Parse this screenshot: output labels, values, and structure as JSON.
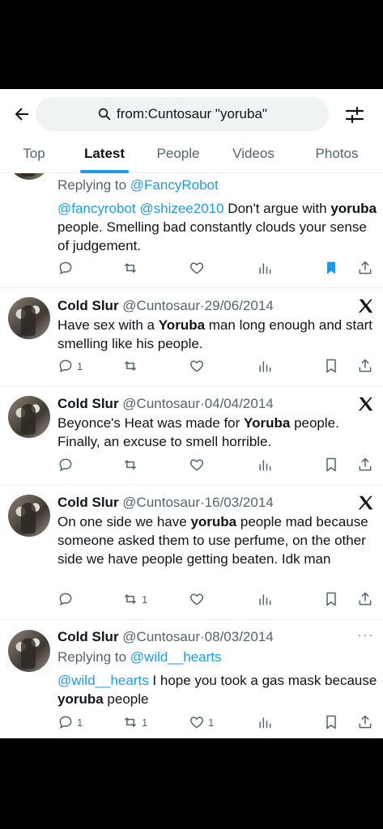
{
  "search": {
    "query": "from:Cuntosaur \"yoruba\""
  },
  "tabs": [
    "Top",
    "Latest",
    "People",
    "Videos",
    "Photos"
  ],
  "accent": "#1d9bf0",
  "tweets": [
    {
      "reply_prefix": "Replying to ",
      "reply_handle": "@FancyRobot",
      "mentions": "@fancyrobot @shizee2010",
      "text_a": " Don't argue with ",
      "bold": "yoruba",
      "text_b": " people. Smelling bad constantly clouds your sense of judgement.",
      "bookmarked": true
    },
    {
      "name": "Cold Slur",
      "handle": "@Cuntosaur",
      "date": "29/06/2014",
      "text_a": "Have sex with a ",
      "bold": "Yoruba",
      "text_b": " man long enough and start smelling like his people.",
      "reply_count": "1"
    },
    {
      "name": "Cold Slur",
      "handle": "@Cuntosaur",
      "date": "04/04/2014",
      "text_a": "Beyonce's Heat was made for ",
      "bold": "Yoruba",
      "text_b": " people. Finally, an excuse to smell horrible."
    },
    {
      "name": "Cold Slur",
      "handle": "@Cuntosaur",
      "date": "16/03/2014",
      "text_a": "On one side we have ",
      "bold": "yoruba",
      "text_b": " people mad because someone asked them to use perfume, on the other side we have people getting beaten. Idk man",
      "retweet_count": "1"
    },
    {
      "name": "Cold Slur",
      "handle": "@Cuntosaur",
      "date": "08/03/2014",
      "reply_prefix": "Replying to ",
      "reply_handle": "@wild__hearts",
      "mentions": "@wild__hearts",
      "text_a": " I hope you took a gas mask because ",
      "bold": "yoruba",
      "text_b": " people",
      "reply_count": "1",
      "retweet_count": "1",
      "like_count": "1"
    }
  ]
}
